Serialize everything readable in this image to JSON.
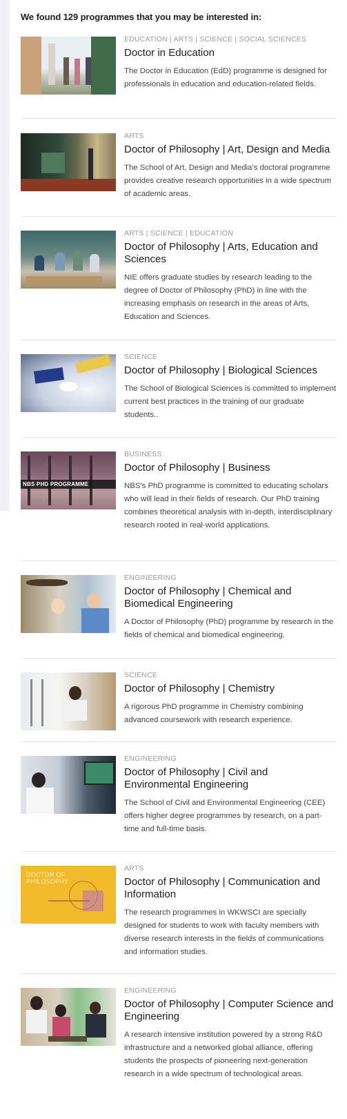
{
  "result_count": "We found 129 programmes that you may be interested in:",
  "programmes": [
    {
      "category": "EDUCATION | ARTS | SCIENCE | SOCIAL SCIENCES",
      "title": "Doctor in Education",
      "description": "The Doctor in Education (EdD) programme is designed for professionals in education and education-related fields.",
      "thumb_overlay": ""
    },
    {
      "category": "ARTS",
      "title": "Doctor of Philosophy | Art, Design and Media",
      "description": "The School of Art, Design and Media's doctoral programme provides creative research opportunities in a wide spectrum of academic areas.",
      "thumb_overlay": ""
    },
    {
      "category": "ARTS | SCIENCE | EDUCATION",
      "title": "Doctor of Philosophy | Arts, Education and Sciences",
      "description": "NIE offers graduate studies by research leading to the degree of Doctor of Philosophy (PhD) in line with the increasing emphasis on research in the areas of Arts, Education and Sciences.",
      "thumb_overlay": ""
    },
    {
      "category": "SCIENCE",
      "title": "Doctor of Philosophy | Biological Sciences",
      "description": "The School of Biological Sciences is committed to implement current best practices in the training of our graduate students..",
      "thumb_overlay": ""
    },
    {
      "category": "BUSINESS",
      "title": "Doctor of Philosophy | Business",
      "description": "NBS's PhD programme is committed to educating scholars who will lead in their fields of research. Our PhD training combines theoretical analysis with in-depth, interdisciplinary research rooted in real-world applications.",
      "thumb_overlay": "NBS PHD PROGRAMME"
    },
    {
      "category": "ENGINEERING",
      "title": "Doctor of Philosophy | Chemical and Biomedical Engineering",
      "description": "A Doctor of Philosophy (PhD) programme by research in the fields of chemical and biomedical engineering.",
      "thumb_overlay": ""
    },
    {
      "category": "SCIENCE",
      "title": "Doctor of Philosophy | Chemistry",
      "description": "A rigorous PhD programme in Chemistry combining advanced coursework with research experience.",
      "thumb_overlay": ""
    },
    {
      "category": "ENGINEERING",
      "title": "Doctor of Philosophy | Civil and Environmental Engineering",
      "description": "The School of Civil and Environmental Engineering (CEE) offers higher degree programmes by research, on a part-time and full-time basis.",
      "thumb_overlay": ""
    },
    {
      "category": "ARTS",
      "title": "Doctor of Philosophy | Communication and Information",
      "description": "The research programmes in WKWSCI are specially designed for students to work with faculty members with diverse research interests in the fields of communications and information studies.",
      "thumb_overlay": "DOCTOR OF PHILOSOPHY"
    },
    {
      "category": "ENGINEERING",
      "title": "Doctor of Philosophy | Computer Science and Engineering",
      "description": "A research intensive institution powered by a strong R&D infrastructure and a networked global alliance, offering students the prospects of pioneering next-generation research in a wide spectrum of technological areas.",
      "thumb_overlay": ""
    }
  ]
}
